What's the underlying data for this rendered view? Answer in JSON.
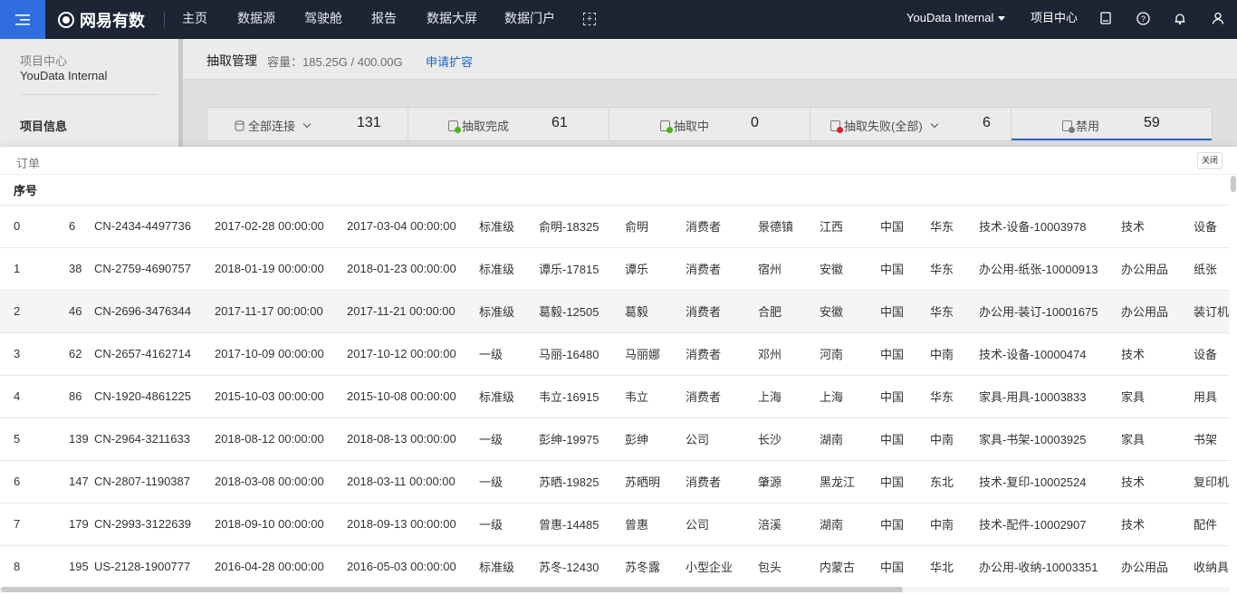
{
  "topbar": {
    "brand": "网易有数",
    "nav": [
      "主页",
      "数据源",
      "驾驶舱",
      "报告",
      "数据大屏",
      "数据门户"
    ],
    "project_select": "YouData Internal",
    "project_center": "项目中心",
    "icons": [
      "menu-icon",
      "logo-icon",
      "add-screen-icon",
      "book-icon",
      "help-icon",
      "bell-icon",
      "user-icon"
    ]
  },
  "sidebar": {
    "sub_label": "项目中心",
    "project_name": "YouData Internal",
    "info": "项目信息"
  },
  "main": {
    "title": "抽取管理",
    "capacity": "容量：185.25G / 400.00G",
    "apply": "申请扩容",
    "stats": [
      {
        "label": "全部连接",
        "count": "131",
        "icon_color": "#888888"
      },
      {
        "label": "抽取完成",
        "count": "61",
        "icon_color": "#52c41a"
      },
      {
        "label": "抽取中",
        "count": "0",
        "icon_color": "#52c41a"
      },
      {
        "label": "抽取失败(全部)",
        "count": "6",
        "icon_color": "#f5222d"
      },
      {
        "label": "禁用",
        "count": "59",
        "icon_color": "#888888"
      }
    ]
  },
  "panel": {
    "title": "订单",
    "close": "关闭",
    "header": "序号",
    "rows": [
      [
        "0",
        "6",
        "CN-2434-4497736",
        "2017-02-28 00:00:00",
        "2017-03-04 00:00:00",
        "标准级",
        "俞明-18325",
        "俞明",
        "消费者",
        "景德镇",
        "江西",
        "中国",
        "华东",
        "技术-设备-10003978",
        "技术",
        "设备"
      ],
      [
        "1",
        "38",
        "CN-2759-4690757",
        "2018-01-19 00:00:00",
        "2018-01-23 00:00:00",
        "标准级",
        "谭乐-17815",
        "谭乐",
        "消费者",
        "宿州",
        "安徽",
        "中国",
        "华东",
        "办公用-纸张-10000913",
        "办公用品",
        "纸张"
      ],
      [
        "2",
        "46",
        "CN-2696-3476344",
        "2017-11-17 00:00:00",
        "2017-11-21 00:00:00",
        "标准级",
        "葛毅-12505",
        "葛毅",
        "消费者",
        "合肥",
        "安徽",
        "中国",
        "华东",
        "办公用-装订-10001675",
        "办公用品",
        "装订机"
      ],
      [
        "3",
        "62",
        "CN-2657-4162714",
        "2017-10-09 00:00:00",
        "2017-10-12 00:00:00",
        "一级",
        "马丽-16480",
        "马丽娜",
        "消费者",
        "邓州",
        "河南",
        "中国",
        "中南",
        "技术-设备-10000474",
        "技术",
        "设备"
      ],
      [
        "4",
        "86",
        "CN-1920-4861225",
        "2015-10-03 00:00:00",
        "2015-10-08 00:00:00",
        "标准级",
        "韦立-16915",
        "韦立",
        "消费者",
        "上海",
        "上海",
        "中国",
        "华东",
        "家具-用具-10003833",
        "家具",
        "用具"
      ],
      [
        "5",
        "139",
        "CN-2964-3211633",
        "2018-08-12 00:00:00",
        "2018-08-13 00:00:00",
        "一级",
        "彭绅-19975",
        "彭绅",
        "公司",
        "长沙",
        "湖南",
        "中国",
        "中南",
        "家具-书架-10003925",
        "家具",
        "书架"
      ],
      [
        "6",
        "147",
        "CN-2807-1190387",
        "2018-03-08 00:00:00",
        "2018-03-11 00:00:00",
        "一级",
        "苏晒-19825",
        "苏晒明",
        "消费者",
        "肇源",
        "黑龙江",
        "中国",
        "东北",
        "技术-复印-10002524",
        "技术",
        "复印机"
      ],
      [
        "7",
        "179",
        "CN-2993-3122639",
        "2018-09-10 00:00:00",
        "2018-09-13 00:00:00",
        "一级",
        "曾惠-14485",
        "曾惠",
        "公司",
        "涪溪",
        "湖南",
        "中国",
        "中南",
        "技术-配件-10002907",
        "技术",
        "配件"
      ],
      [
        "8",
        "195",
        "US-2128-1900777",
        "2016-04-28 00:00:00",
        "2016-05-03 00:00:00",
        "标准级",
        "苏冬-12430",
        "苏冬露",
        "小型企业",
        "包头",
        "内蒙古",
        "中国",
        "华北",
        "办公用-收纳-10003351",
        "办公用品",
        "收纳具"
      ]
    ]
  }
}
